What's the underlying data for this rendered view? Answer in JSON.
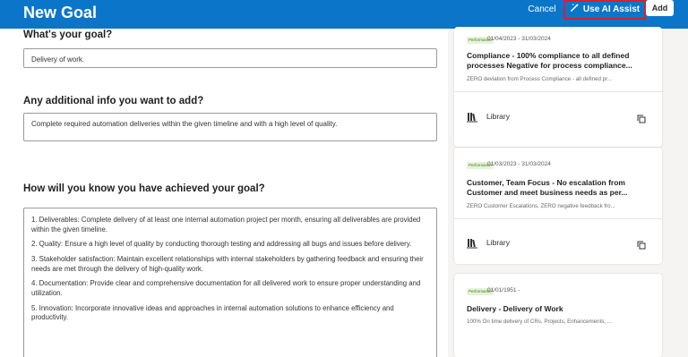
{
  "header": {
    "title": "New Goal",
    "cancel_label": "Cancel",
    "ai_assist_label": "Use AI Assist",
    "add_label": "Add"
  },
  "form": {
    "goal_label": "What's your goal?",
    "goal_value": "Delivery of work.",
    "info_label": "Any additional info you want to add?",
    "info_value": "Complete required automation deliveries within the given timeline and with a high level of quality.",
    "measure_label": "How will you know you have achieved your goal?",
    "measure_lines": [
      "1. Deliverables: Complete delivery of at least one internal automation project per month, ensuring all deliverables are provided within the given timeline.",
      "2. Quality: Ensure a high level of quality by conducting thorough testing and addressing all bugs and issues before delivery.",
      "3. Stakeholder satisfaction: Maintain excellent relationships with internal stakeholders by gathering feedback and ensuring their needs are met through the delivery of high-quality work.",
      "4. Documentation: Provide clear and comprehensive documentation for all delivered work to ensure proper understanding and utilization.",
      "5. Innovation: Incorporate innovative ideas and approaches in internal automation solutions to enhance efficiency and productivity."
    ]
  },
  "suggestions": [
    {
      "badge": "Performance",
      "date": "01/04/2023 - 31/03/2024",
      "title": "Compliance - 100% compliance to all defined processes Negative for process compliance...",
      "desc": "ZERO deviation from Process Compliance - all defined pr...",
      "library_label": "Library"
    },
    {
      "badge": "Performance",
      "date": "01/03/2023 - 31/03/2024",
      "title": "Customer, Team Focus - No escalation from Customer and meet business needs as per...",
      "desc": "ZERO Customer Escalations, ZERO negative feedback fro...",
      "library_label": "Library"
    },
    {
      "badge": "Performance",
      "date": "01/01/1951 -",
      "title": "Delivery - Delivery of Work",
      "desc": "100% On time delivery of CRs, Projects, Enhancements, ..."
    }
  ],
  "colors": {
    "header_bg": "#0b76c9",
    "highlight_border": "#d6202e",
    "badge_bg": "#e6f3d8",
    "badge_text": "#3d7d1b"
  },
  "icons": [
    "magic-wand-icon",
    "library-icon",
    "copy-icon"
  ]
}
